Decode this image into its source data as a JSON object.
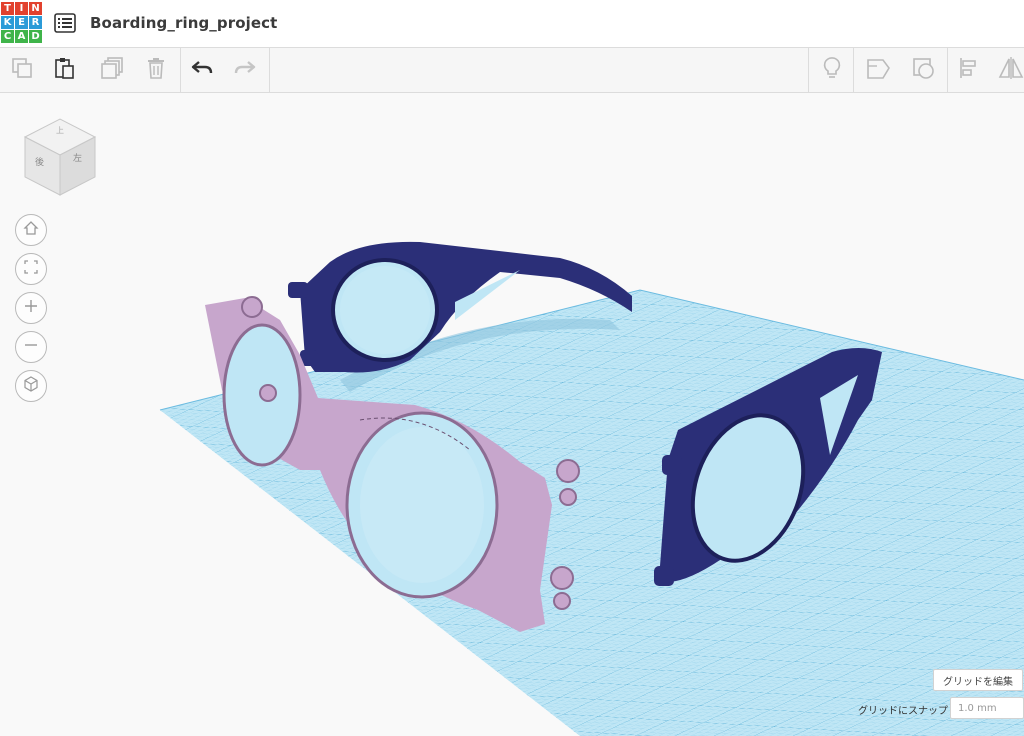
{
  "app": {
    "logo_letters": [
      "T",
      "I",
      "N",
      "K",
      "E",
      "R",
      "C",
      "A",
      "D"
    ],
    "logo_colors": [
      "#e2412e",
      "#e2412e",
      "#e2412e",
      "#2b9bd8",
      "#2b9bd8",
      "#2b9bd8",
      "#3fb44a",
      "#3fb44a",
      "#3fb44a"
    ],
    "project_title": "Boarding_ring_project"
  },
  "toolbar": {
    "left_tools": [
      {
        "name": "copy",
        "icon": "copy-icon",
        "enabled": false
      },
      {
        "name": "paste",
        "icon": "paste-icon",
        "enabled": true
      },
      {
        "name": "duplicate",
        "icon": "duplicate-icon",
        "enabled": false
      },
      {
        "name": "delete",
        "icon": "trash-icon",
        "enabled": false
      },
      {
        "name": "undo",
        "icon": "undo-icon",
        "enabled": true
      },
      {
        "name": "redo",
        "icon": "redo-icon",
        "enabled": false
      }
    ],
    "right_tools": [
      {
        "name": "notes",
        "icon": "lightbulb-icon"
      },
      {
        "name": "hole",
        "icon": "hole-shape-icon"
      },
      {
        "name": "group",
        "icon": "group-icon"
      },
      {
        "name": "align",
        "icon": "align-icon"
      },
      {
        "name": "mirror",
        "icon": "mirror-icon"
      }
    ]
  },
  "viewcube": {
    "top": "上",
    "front": "後",
    "side": "左"
  },
  "nav": [
    {
      "name": "home-view",
      "icon": "home-icon"
    },
    {
      "name": "fit-all",
      "icon": "fit-view-icon"
    },
    {
      "name": "zoom-in",
      "icon": "zoom-in-icon"
    },
    {
      "name": "zoom-out",
      "icon": "zoom-out-icon"
    },
    {
      "name": "perspective",
      "icon": "perspective-icon"
    }
  ],
  "workplane": {
    "edit_grid_label": "グリッドを編集",
    "snap_label": "グリッドにスナップ",
    "snap_value": "1.0 mm",
    "grid_color": "#9bd7ef",
    "frame_color": "#c7a6cc",
    "temple_color": "#2b2f78"
  }
}
